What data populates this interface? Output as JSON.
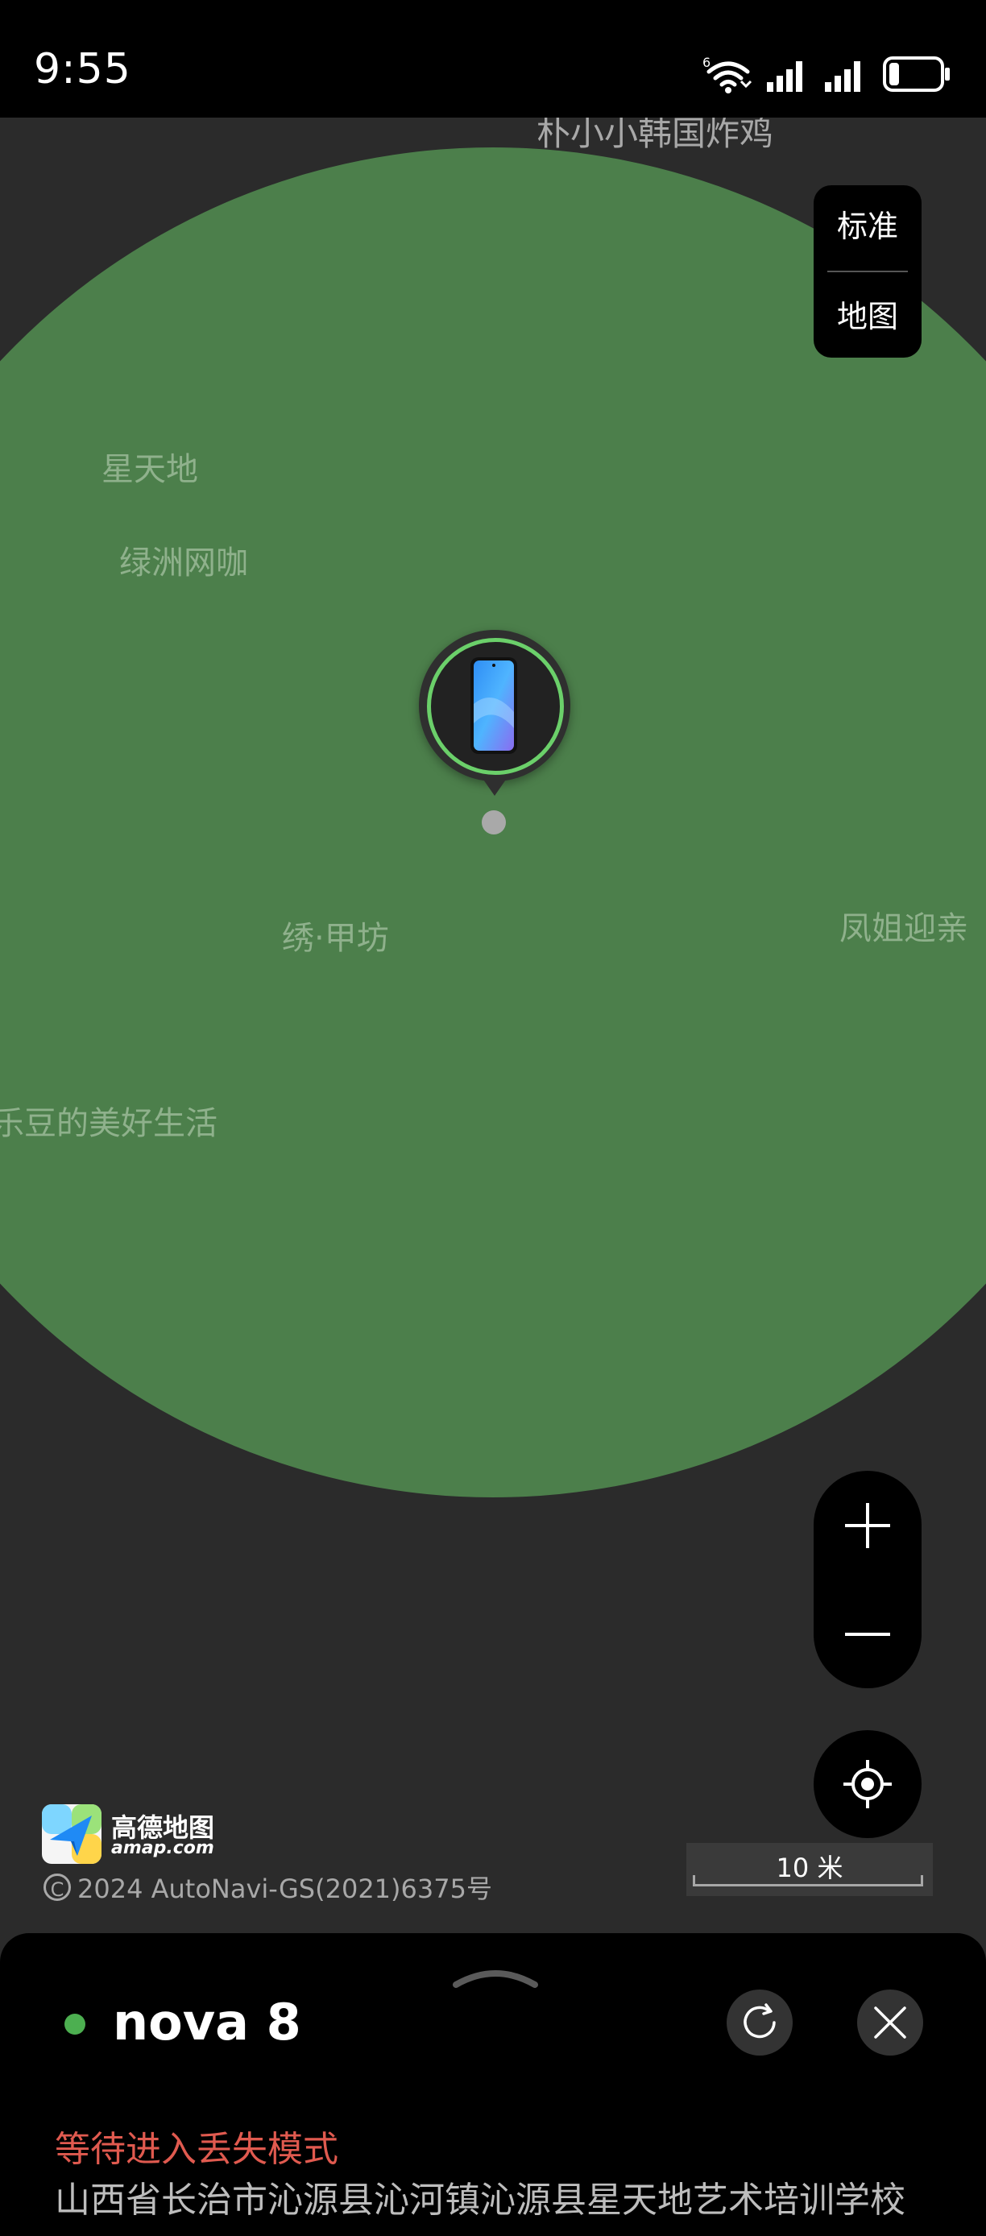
{
  "status_bar": {
    "time": "9:55",
    "wifi_badge": "6",
    "battery_percent": 20
  },
  "map": {
    "map_type_toggle": [
      "标准",
      "地图"
    ],
    "pois": {
      "top": "朴小小韩国炸鸡",
      "xingtiandi": "星天地",
      "lvzhou": "绿洲网咖",
      "xiujiafang": "绣·甲坊",
      "fengjie": "凤姐迎亲",
      "doudou": "乐豆的美好生活"
    },
    "accuracy_circle_color": "#4c7f4b",
    "marker_ring_color": "#6bd06a",
    "provider": {
      "name": "高德地图",
      "domain": "amap.com",
      "copyright": "2024 AutoNavi-GS(2021)6375号"
    },
    "scale": "10 米",
    "icons": {
      "zoom_in": "plus-icon",
      "zoom_out": "minus-icon",
      "locate": "locate-crosshair-icon"
    }
  },
  "device": {
    "name": "nova 8",
    "online_color": "#4caf50",
    "lost_mode_status": "等待进入丢失模式",
    "lost_mode_color": "#e05a4f",
    "address": "山西省长治市沁源县沁河镇沁源县星天地艺术培训学校"
  }
}
